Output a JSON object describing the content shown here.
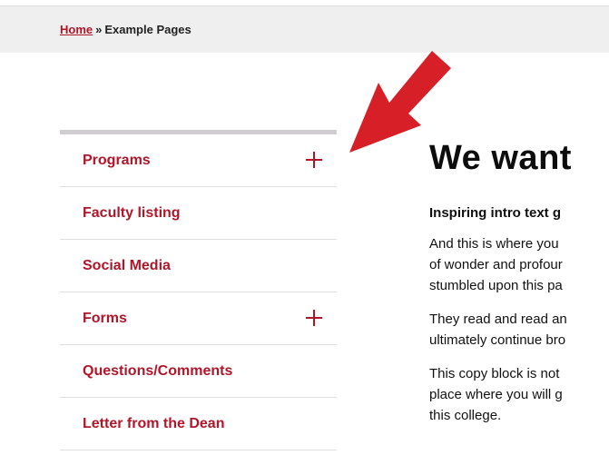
{
  "breadcrumb": {
    "home_label": "Home",
    "separator": "»",
    "current_label": "Example Pages"
  },
  "sidebar": {
    "items": [
      {
        "label": "Programs",
        "expandable": true
      },
      {
        "label": "Faculty listing",
        "expandable": false
      },
      {
        "label": "Social Media",
        "expandable": false
      },
      {
        "label": "Forms",
        "expandable": true
      },
      {
        "label": "Questions/Comments",
        "expandable": false
      },
      {
        "label": "Letter from the Dean",
        "expandable": false
      }
    ]
  },
  "main": {
    "title": "We want",
    "intro": "Inspiring intro text g",
    "paragraphs": [
      [
        "And this is where you",
        "of wonder and profour",
        "stumbled upon this pa"
      ],
      [
        "They read and read an",
        "ultimately continue bro"
      ],
      [
        "This copy block is not",
        "place where you will g",
        "this college."
      ]
    ]
  },
  "colors": {
    "accent": "#b0162a",
    "arrow": "#d71f27",
    "breadcrumb_bg": "#efefef",
    "nav_top_border": "#cfcdd0"
  },
  "icons": {
    "expand": "plus-icon",
    "pointer": "red-arrow-annotation"
  }
}
